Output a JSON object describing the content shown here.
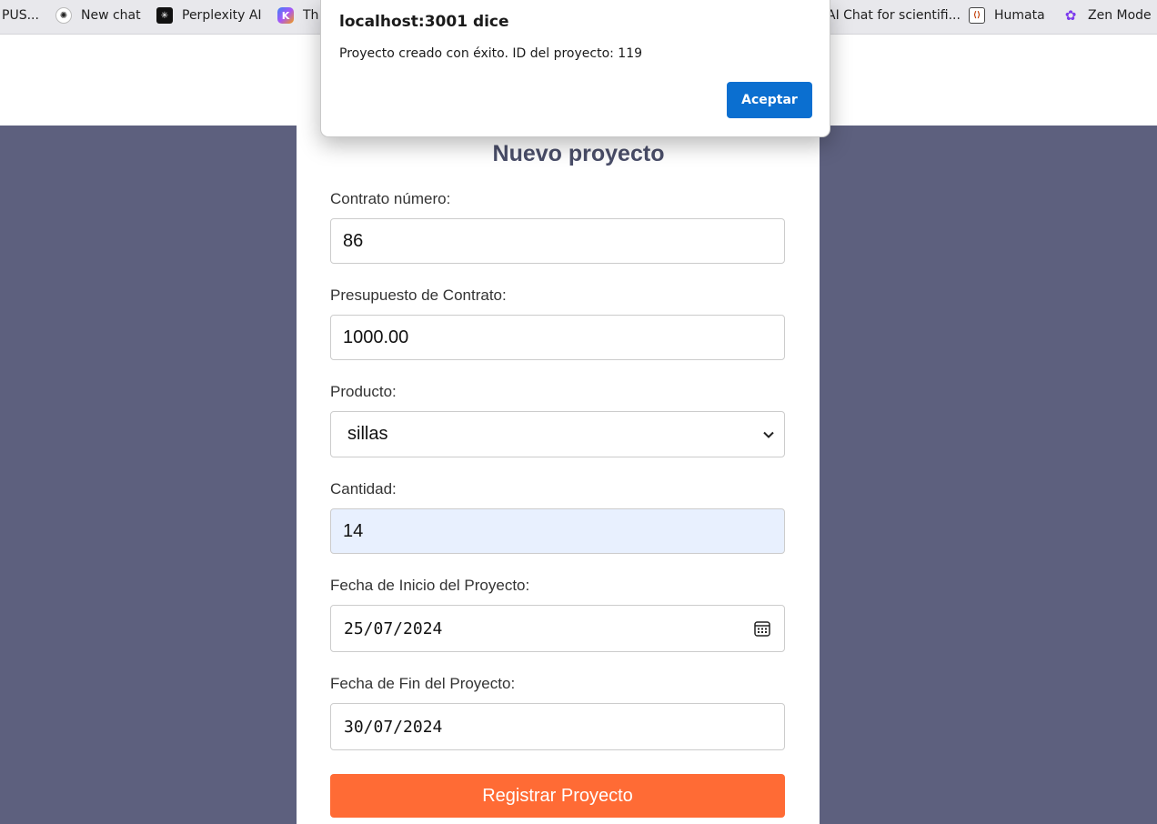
{
  "bookmarks": [
    {
      "label": "PUS...",
      "icon": "none"
    },
    {
      "label": "New chat",
      "icon": "openai-icon"
    },
    {
      "label": "Perplexity AI",
      "icon": "perplexity-icon"
    },
    {
      "label": "Th",
      "icon": "app-icon"
    },
    {
      "label": "AI Chat for scientifi...",
      "icon": "none"
    },
    {
      "label": "Humata",
      "icon": "humata-icon"
    },
    {
      "label": "Zen Mode",
      "icon": "zen-icon"
    }
  ],
  "form": {
    "title": "Nuevo proyecto",
    "fields": [
      {
        "label": "Contrato número:",
        "value": "86"
      },
      {
        "label": "Presupuesto de Contrato:",
        "value": "1000.00"
      },
      {
        "label": "Producto:",
        "value": "sillas"
      },
      {
        "label": "Cantidad:",
        "value": "14"
      },
      {
        "label": "Fecha de Inicio del Proyecto:",
        "value": "25/07/2024"
      },
      {
        "label": "Fecha de Fin del Proyecto:",
        "value": "30/07/2024"
      }
    ],
    "submit_label": "Registrar Proyecto"
  },
  "dialog": {
    "title": "localhost:3001 dice",
    "message": "Proyecto creado con éxito. ID del proyecto: 119",
    "ok_label": "Aceptar"
  },
  "colors": {
    "page_bg": "#5d607e",
    "title": "#4a4e69",
    "submit": "#ff6b35",
    "dialog_button": "#0b6fd0",
    "autofill_bg": "#e8f0fe"
  }
}
